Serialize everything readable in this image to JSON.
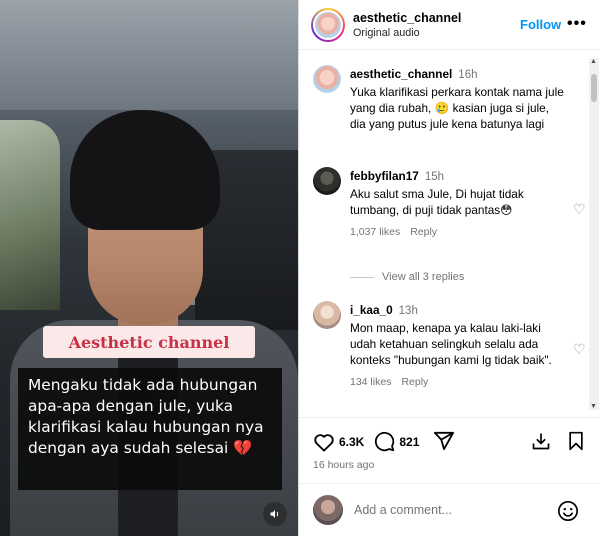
{
  "video": {
    "tag": "Aesthetic channel",
    "caption": "Mengaku tidak ada hubungan apa-apa dengan jule, yuka klarifikasi kalau hubungan nya dengan aya sudah selesai 💔"
  },
  "header": {
    "username": "aesthetic_channel",
    "audio": "Original audio",
    "follow": "Follow",
    "more": "•••"
  },
  "comments": [
    {
      "username": "aesthetic_channel",
      "time": "16h",
      "text": "Yuka klarifikasi perkara kontak nama jule yang dia rubah, 🥲 kasian juga si jule, dia yang putus jule kena batunya lagi"
    },
    {
      "username": "febbyfilan17",
      "time": "15h",
      "text": "Aku salut sma Jule, Di hujat tidak tumbang, di puji tidak pantas😳",
      "likes": "1,037 likes",
      "reply": "Reply"
    },
    {
      "username": "i_kaa_0",
      "time": "13h",
      "text": "Mon maap, kenapa ya kalau laki-laki udah ketahuan selingkuh selalu ada konteks \"hubungan kami lg tidak baik\".",
      "likes": "134 likes",
      "reply": "Reply"
    }
  ],
  "view_replies": "View all 3 replies",
  "actions": {
    "likes": "6.3K",
    "comments": "821",
    "time_ago": "16 hours ago"
  },
  "add_comment": {
    "placeholder": "Add a comment..."
  },
  "colors": {
    "accent": "#0095f6",
    "tag_text": "#c73245",
    "tag_bg": "#fbe9ea",
    "caption_bg": "#0c0c0c"
  },
  "icons": [
    "heart-icon",
    "comment-icon",
    "share-icon",
    "download-icon",
    "bookmark-icon",
    "emoji-icon",
    "mute-icon"
  ]
}
